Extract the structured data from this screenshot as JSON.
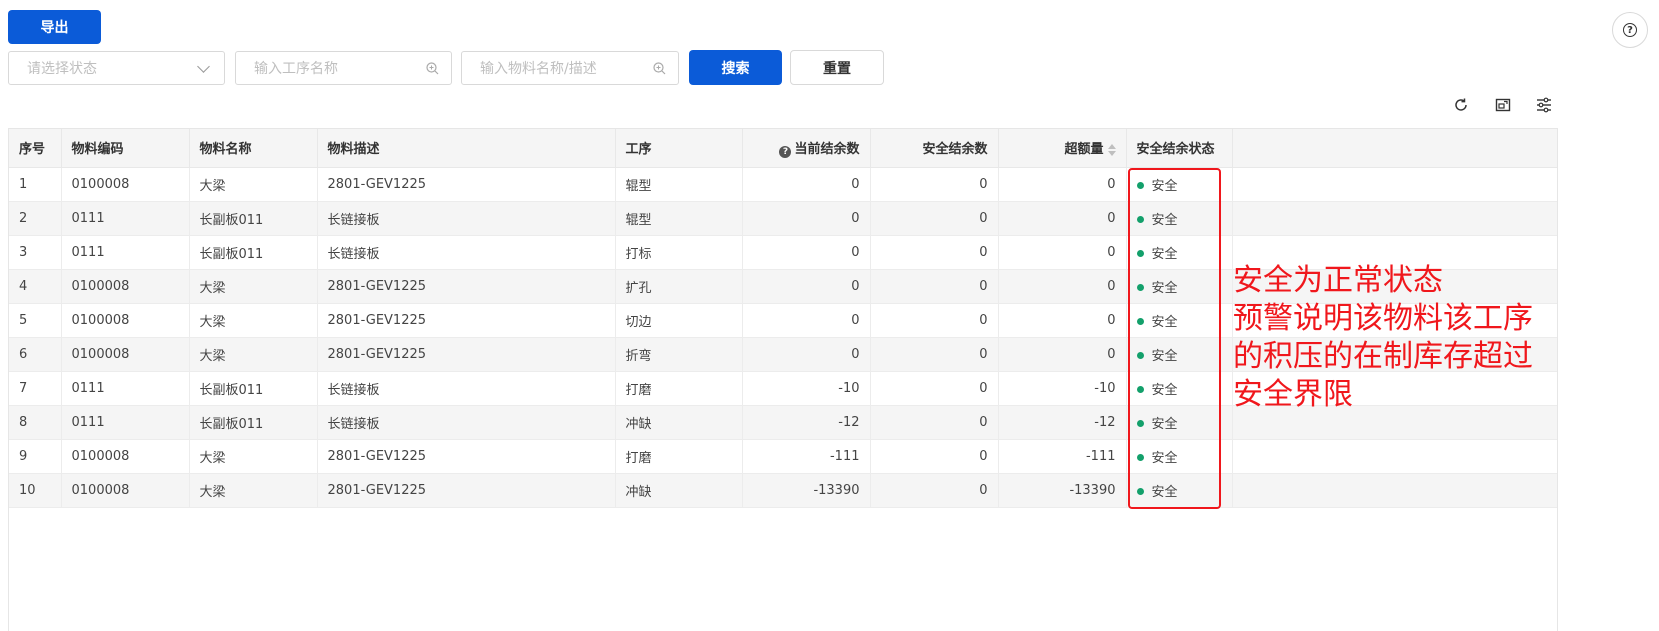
{
  "toolbar": {
    "export_label": "导出",
    "search_label": "搜索",
    "reset_label": "重置"
  },
  "filters": {
    "status_placeholder": "请选择状态",
    "process_placeholder": "输入工序名称",
    "material_placeholder": "输入物料名称/描述"
  },
  "table": {
    "columns": [
      "序号",
      "物料编码",
      "物料名称",
      "物料描述",
      "工序",
      "当前结余数",
      "安全结余数",
      "超额量",
      "安全结余状态"
    ],
    "rows": [
      [
        "1",
        "0100008",
        "大梁",
        "2801-GEV1225",
        "辊型",
        "0",
        "0",
        "0",
        "安全"
      ],
      [
        "2",
        "0111",
        "长副板011",
        "长链接板",
        "辊型",
        "0",
        "0",
        "0",
        "安全"
      ],
      [
        "3",
        "0111",
        "长副板011",
        "长链接板",
        "打标",
        "0",
        "0",
        "0",
        "安全"
      ],
      [
        "4",
        "0100008",
        "大梁",
        "2801-GEV1225",
        "扩孔",
        "0",
        "0",
        "0",
        "安全"
      ],
      [
        "5",
        "0100008",
        "大梁",
        "2801-GEV1225",
        "切边",
        "0",
        "0",
        "0",
        "安全"
      ],
      [
        "6",
        "0100008",
        "大梁",
        "2801-GEV1225",
        "折弯",
        "0",
        "0",
        "0",
        "安全"
      ],
      [
        "7",
        "0111",
        "长副板011",
        "长链接板",
        "打磨",
        "-10",
        "0",
        "-10",
        "安全"
      ],
      [
        "8",
        "0111",
        "长副板011",
        "长链接板",
        "冲缺",
        "-12",
        "0",
        "-12",
        "安全"
      ],
      [
        "9",
        "0100008",
        "大梁",
        "2801-GEV1225",
        "打磨",
        "-111",
        "0",
        "-111",
        "安全"
      ],
      [
        "10",
        "0100008",
        "大梁",
        "2801-GEV1225",
        "冲缺",
        "-13390",
        "0",
        "-13390",
        "安全"
      ]
    ]
  },
  "annotation": {
    "lines": [
      "安全为正常状态",
      "预警说明该物料该工序",
      "的积压的在制库存超过",
      "安全界限"
    ]
  },
  "colors": {
    "primary": "#0b5bd8",
    "safe": "#13a06b",
    "annotation": "#f0171c"
  },
  "icons": {
    "help": "help-icon",
    "refresh": "refresh-icon",
    "fullscreen": "fullscreen-icon",
    "settings": "column-settings-icon"
  }
}
